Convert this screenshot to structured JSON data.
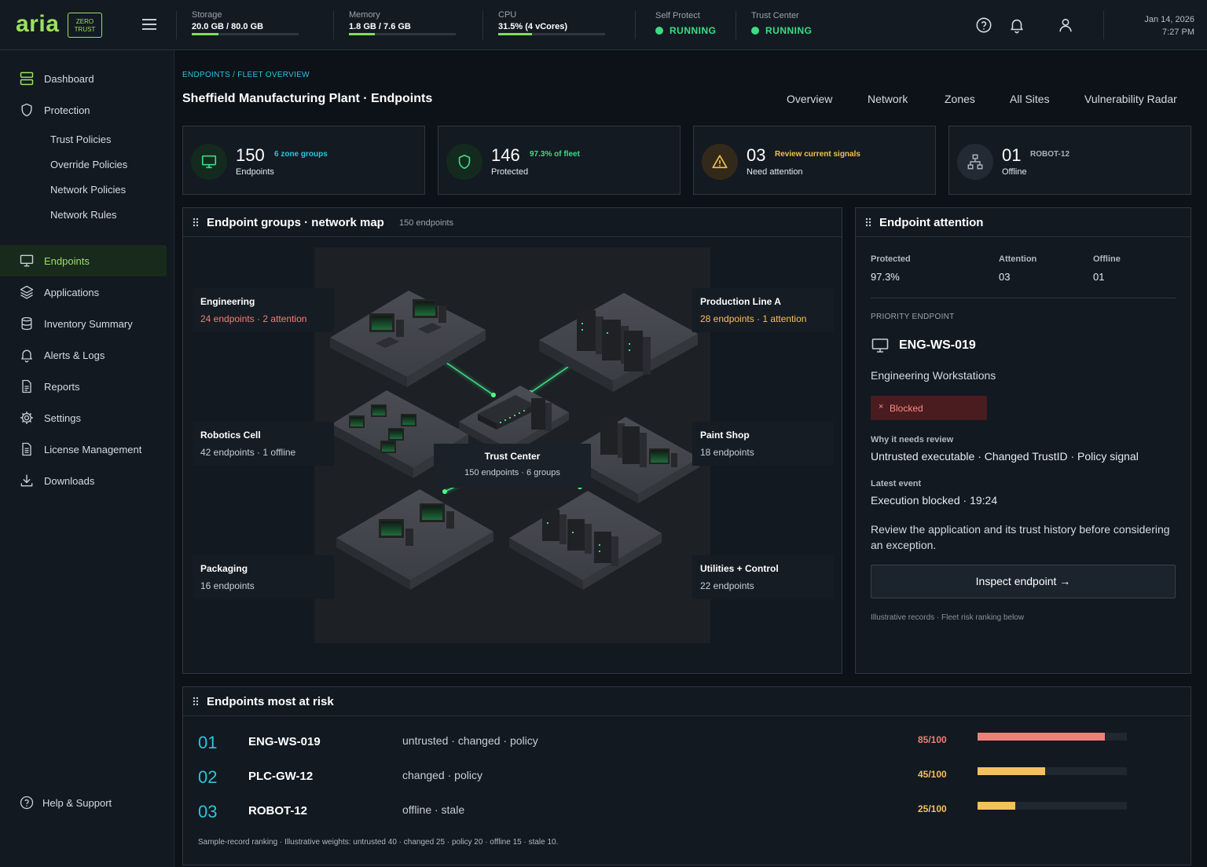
{
  "app": {
    "logo": "aria",
    "badge_line1": "ZERO",
    "badge_line2": "TRUST"
  },
  "topbar": {
    "storage": {
      "label": "Storage",
      "value": "20.0 GB / 80.0 GB",
      "fill": 0.25
    },
    "memory": {
      "label": "Memory",
      "value": "1.8 GB / 7.6 GB",
      "fill": 0.24
    },
    "cpu": {
      "label": "CPU",
      "value": "31.5% (4 vCores)",
      "fill": 0.315
    },
    "self_protect": {
      "label": "Self Protect",
      "value": "RUNNING"
    },
    "trust_center": {
      "label": "Trust Center",
      "value": "RUNNING"
    },
    "date": "Jan 14, 2026",
    "time": "7:27 PM",
    "icons": [
      "help-icon",
      "bell-icon",
      "user-icon"
    ]
  },
  "sidebar": {
    "dashboard": "Dashboard",
    "protection": "Protection",
    "trust_policies": "Trust Policies",
    "override_policies": "Override Policies",
    "network_policies": "Network Policies",
    "network_rules": "Network Rules",
    "endpoints": "Endpoints",
    "applications": "Applications",
    "inventory_summary": "Inventory Summary",
    "alerts_logs": "Alerts & Logs",
    "reports": "Reports",
    "settings": "Settings",
    "license_management": "License Management",
    "downloads": "Downloads",
    "help_support": "Help & Support"
  },
  "page": {
    "breadcrumb": "ENDPOINTS / FLEET OVERVIEW",
    "title": "Sheffield Manufacturing Plant · Endpoints",
    "tabs": [
      "Overview",
      "Network",
      "Zones",
      "All Sites",
      "Vulnerability Radar"
    ]
  },
  "kpis": [
    {
      "number": "150",
      "sub": "6 zone groups",
      "caption": "Endpoints",
      "color": "#2fc3d8"
    },
    {
      "number": "146",
      "sub": "97.3% of fleet",
      "caption": "Protected",
      "color": "#3ddc84"
    },
    {
      "number": "03",
      "sub": "Review current signals",
      "caption": "Need attention",
      "color": "#f2c14e"
    },
    {
      "number": "01",
      "sub": "ROBOT-12",
      "caption": "Offline",
      "color": "#9aa3ad"
    }
  ],
  "map_panel": {
    "title": "Endpoint groups · network map",
    "count": "150 endpoints",
    "groups": {
      "engineering": {
        "name": "Engineering",
        "detail": "24 endpoints · 2 attention"
      },
      "production": {
        "name": "Production Line A",
        "detail": "28 endpoints · 1 attention"
      },
      "robotics": {
        "name": "Robotics Cell",
        "detail": "42 endpoints · 1 offline"
      },
      "paint": {
        "name": "Paint Shop",
        "detail": "18 endpoints"
      },
      "packaging": {
        "name": "Packaging",
        "detail": "16 endpoints"
      },
      "utilities": {
        "name": "Utilities + Control",
        "detail": "22 endpoints"
      }
    },
    "trust_center": {
      "name": "Trust Center",
      "detail": "150 endpoints · 6 groups"
    }
  },
  "attention_panel": {
    "title": "Endpoint attention",
    "stats": [
      {
        "label": "Protected",
        "value": "97.3%"
      },
      {
        "label": "Attention",
        "value": "03"
      },
      {
        "label": "Offline",
        "value": "01"
      }
    ],
    "priority_label": "PRIORITY ENDPOINT",
    "endpoint_id": "ENG-WS-019",
    "endpoint_group": "Engineering Workstations",
    "status": "Blocked",
    "why_label": "Why it needs review",
    "why_value": "Untrusted executable · Changed TrustID · Policy signal",
    "event_label": "Latest event",
    "event_value": "Execution blocked · 19:24",
    "advice": "Review the application and its trust history before considering an exception.",
    "button": "Inspect endpoint →",
    "footnote": "Illustrative records · Fleet risk ranking below"
  },
  "risk_panel": {
    "title": "Endpoints most at risk",
    "rows": [
      {
        "rank": "01",
        "id": "ENG-WS-019",
        "tags": "untrusted · changed · policy",
        "score": "85/100",
        "value": 85,
        "color": "#f07f7a"
      },
      {
        "rank": "02",
        "id": "PLC-GW-12",
        "tags": "changed · policy",
        "score": "45/100",
        "value": 45,
        "color": "#f5c15c"
      },
      {
        "rank": "03",
        "id": "ROBOT-12",
        "tags": "offline · stale",
        "score": "25/100",
        "value": 25,
        "color": "#f5c15c"
      }
    ],
    "footnote": "Sample-record ranking · Illustrative weights: untrusted 40 · changed 25 · policy 20 · offline 15 · stale 10."
  }
}
